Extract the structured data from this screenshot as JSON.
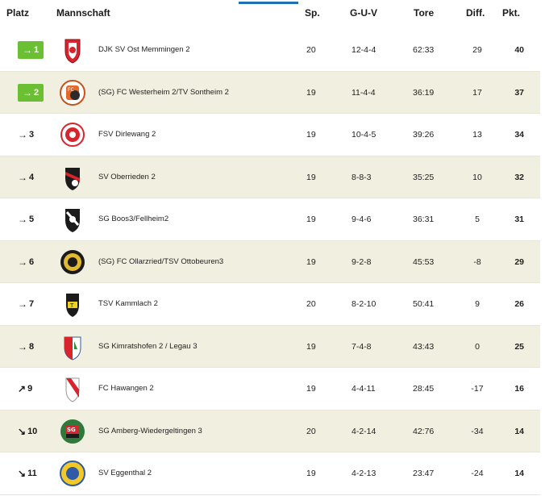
{
  "header": {
    "platz": "Platz",
    "mannschaft": "Mannschaft",
    "sp": "Sp.",
    "guv": "G-U-V",
    "tore": "Tore",
    "diff": "Diff.",
    "pkt": "Pkt."
  },
  "colors": {
    "promotion": "#6bbf32",
    "row_alt": "#f1efdf",
    "accent": "#1f6fb5"
  },
  "rows": [
    {
      "arrow": "→",
      "rank": "1",
      "promo": true,
      "team": "DJK SV Ost Memmingen 2",
      "sp": "20",
      "guv": "12-4-4",
      "tore": "62:33",
      "diff": "29",
      "pkt": "40",
      "crest_icon": "red-white-shield-crest"
    },
    {
      "arrow": "→",
      "rank": "2",
      "promo": true,
      "team": "(SG) FC Westerheim 2/TV Sontheim 2",
      "sp": "19",
      "guv": "11-4-4",
      "tore": "36:19",
      "diff": "17",
      "pkt": "37",
      "crest_icon": "fc-round-crest"
    },
    {
      "arrow": "→",
      "rank": "3",
      "promo": false,
      "team": "FSV Dirlewang 2",
      "sp": "19",
      "guv": "10-4-5",
      "tore": "39:26",
      "diff": "13",
      "pkt": "34",
      "crest_icon": "red-round-crest"
    },
    {
      "arrow": "→",
      "rank": "4",
      "promo": false,
      "team": "SV Oberrieden 2",
      "sp": "19",
      "guv": "8-8-3",
      "tore": "35:25",
      "diff": "10",
      "pkt": "32",
      "crest_icon": "black-red-shield-crest"
    },
    {
      "arrow": "→",
      "rank": "5",
      "promo": false,
      "team": "SG Boos3/Fellheim2",
      "sp": "19",
      "guv": "9-4-6",
      "tore": "36:31",
      "diff": "5",
      "pkt": "31",
      "crest_icon": "black-white-shield-crest"
    },
    {
      "arrow": "→",
      "rank": "6",
      "promo": false,
      "team": "(SG) FC Ollarzried/TSV Ottobeuren3",
      "sp": "19",
      "guv": "9-2-8",
      "tore": "45:53",
      "diff": "-8",
      "pkt": "29",
      "crest_icon": "black-gold-round-crest"
    },
    {
      "arrow": "→",
      "rank": "7",
      "promo": false,
      "team": "TSV Kammlach 2",
      "sp": "20",
      "guv": "8-2-10",
      "tore": "50:41",
      "diff": "9",
      "pkt": "26",
      "crest_icon": "black-yellow-shield-crest"
    },
    {
      "arrow": "→",
      "rank": "8",
      "promo": false,
      "team": "SG Kimratshofen 2 / Legau 3",
      "sp": "19",
      "guv": "7-4-8",
      "tore": "43:43",
      "diff": "0",
      "pkt": "25",
      "crest_icon": "red-blue-green-crest"
    },
    {
      "arrow": "↗",
      "rank": "9",
      "promo": false,
      "team": "FC Hawangen 2",
      "sp": "19",
      "guv": "4-4-11",
      "tore": "28:45",
      "diff": "-17",
      "pkt": "16",
      "crest_icon": "red-white-diagonal-crest"
    },
    {
      "arrow": "↘",
      "rank": "10",
      "promo": false,
      "team": "SG Amberg-Wiedergeltingen 3",
      "sp": "20",
      "guv": "4-2-14",
      "tore": "42:76",
      "diff": "-34",
      "pkt": "14",
      "crest_icon": "sg-green-red-round-crest"
    },
    {
      "arrow": "↘",
      "rank": "11",
      "promo": false,
      "team": "SV Eggenthal 2",
      "sp": "19",
      "guv": "4-2-13",
      "tore": "23:47",
      "diff": "-24",
      "pkt": "14",
      "crest_icon": "blue-yellow-round-crest"
    }
  ]
}
